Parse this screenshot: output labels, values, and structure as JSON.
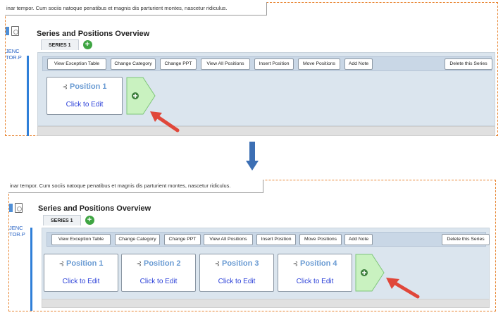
{
  "colors": {
    "accent_blue": "#2f7fd8",
    "dashed_border": "#e8832f",
    "add_green": "#3fa543",
    "panel_bg": "#dbe5ee",
    "arrow_red": "#e0473a",
    "link_blue": "#2a3fd8"
  },
  "icons": [
    "pdf-icon",
    "add-circle-icon",
    "tree-icon",
    "add-position-icon",
    "down-arrow-icon",
    "callout-arrow-icon"
  ],
  "before": {
    "lorem": "inar tempor. Cum sociis natoque penatibus et magnis dis parturient montes, nascetur ridiculus.",
    "side_text_1": "JENC",
    "side_text_2": "TOR.P",
    "title": "Series and Positions Overview",
    "tab": "SERIES 1",
    "toolbar": {
      "view_exception": "View Exception Table",
      "change_category": "Change Category",
      "change_ppt": "Change PPT",
      "view_all_positions": "View All Positions",
      "insert_position": "Insert Position",
      "move_positions": "Move Positions",
      "add_note": "Add Note",
      "delete_series": "Delete this Series"
    },
    "positions": [
      {
        "label": "Position 1",
        "edit": "Click to Edit"
      }
    ]
  },
  "after": {
    "lorem": "inar tempor. Cum sociis natoque penatibus et magnis dis parturient montes, nascetur ridiculus.",
    "side_text_1": "JENC",
    "side_text_2": "TOR.P",
    "title": "Series and Positions Overview",
    "tab": "SERIES 1",
    "toolbar": {
      "view_exception": "View Exception Table",
      "change_category": "Change Category",
      "change_ppt": "Change PPT",
      "view_all_positions": "View All Positions",
      "insert_position": "Insert Position",
      "move_positions": "Move Positions",
      "add_note": "Add Note",
      "delete_series": "Delete this Series"
    },
    "positions": [
      {
        "label": "Position 1",
        "edit": "Click to Edit"
      },
      {
        "label": "Position 2",
        "edit": "Click to Edit"
      },
      {
        "label": "Position 3",
        "edit": "Click to Edit"
      },
      {
        "label": "Position 4",
        "edit": "Click to Edit"
      }
    ]
  }
}
